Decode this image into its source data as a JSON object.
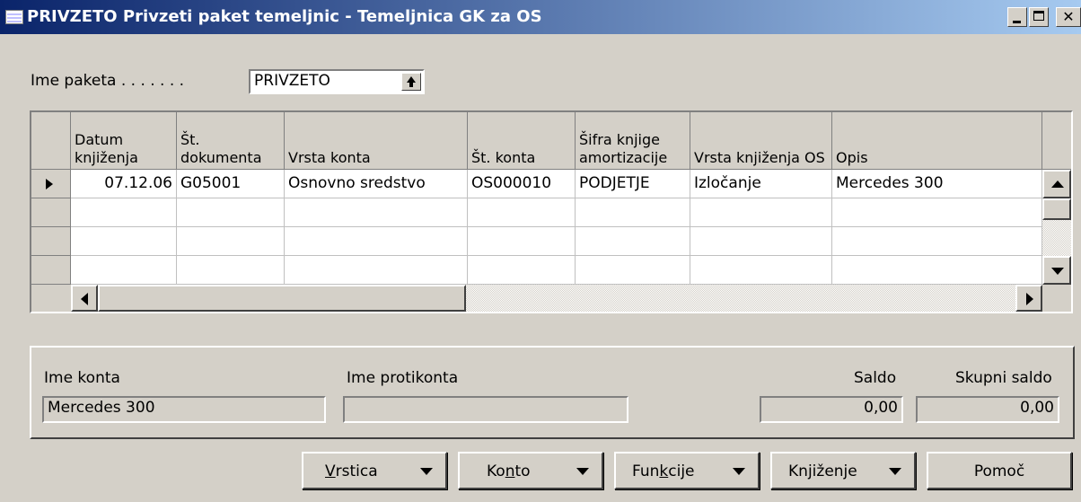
{
  "window": {
    "title": "PRIVZETO Privzeti paket temeljnic - Temeljnica GK za OS",
    "min_icon": "minimize-icon",
    "max_icon": "maximize-icon",
    "close_icon": "close-icon"
  },
  "batch": {
    "label": "Ime paketa . . . . . . .",
    "value": "PRIVZETO",
    "lookup_icon": "up-arrow-icon"
  },
  "grid": {
    "columns": [
      "Datum knjiženja",
      "Št. dokumenta",
      "Vrsta konta",
      "Št. konta",
      "Šifra knjige amortizacije",
      "Vrsta knjiženja OS",
      "Opis"
    ],
    "rows": [
      [
        "07.12.06",
        "G05001",
        "Osnovno sredstvo",
        "OS000010",
        "PODJETJE",
        "Izločanje",
        "Mercedes 300"
      ],
      [
        "",
        "",
        "",
        "",
        "",
        "",
        ""
      ],
      [
        "",
        "",
        "",
        "",
        "",
        "",
        ""
      ],
      [
        "",
        "",
        "",
        "",
        "",
        "",
        ""
      ]
    ]
  },
  "footer": {
    "account_name_label": "Ime konta",
    "account_name_value": "Mercedes 300",
    "balance_account_label": "Ime protikonta",
    "balance_account_value": "",
    "balance_label": "Saldo",
    "balance_value": "0,00",
    "total_balance_label": "Skupni saldo",
    "total_balance_value": "0,00"
  },
  "buttons": {
    "line": {
      "pre": "",
      "key": "V",
      "post": "rstica"
    },
    "account": {
      "pre": "Ko",
      "key": "n",
      "post": "to"
    },
    "functions": {
      "pre": "Fun",
      "key": "k",
      "post": "cije"
    },
    "posting": {
      "pre": "Kn",
      "key": "j",
      "post": "iženje"
    },
    "help": "Pomoč"
  }
}
